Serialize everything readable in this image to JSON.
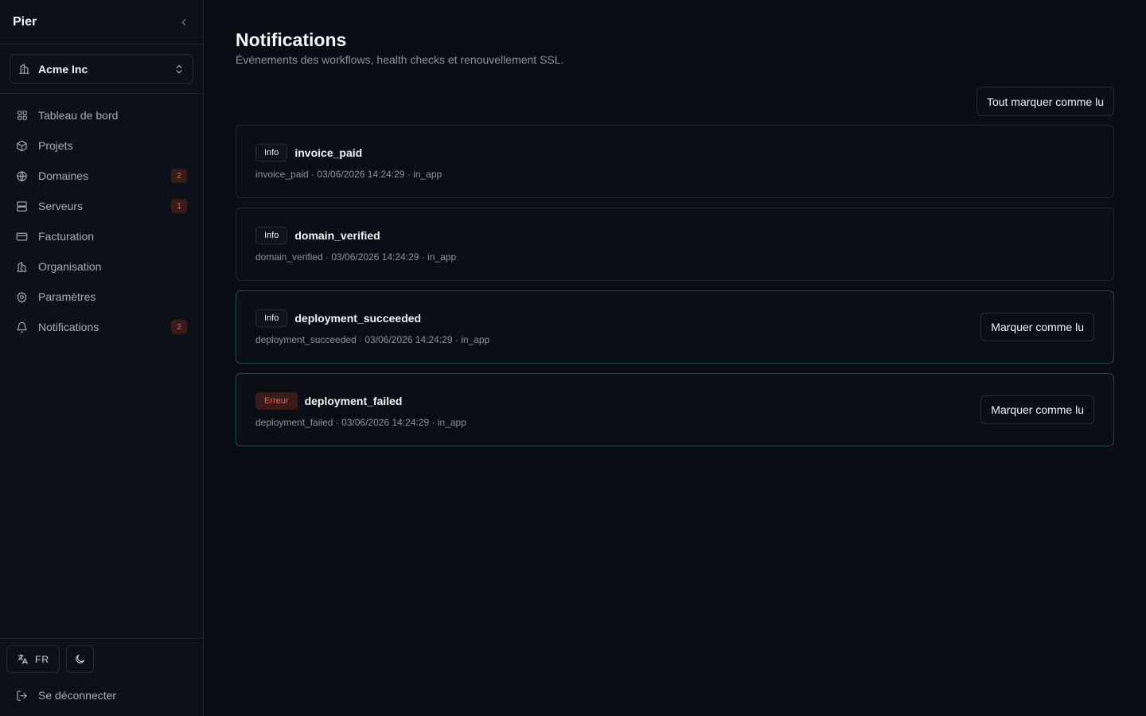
{
  "app": {
    "brand": "Pier"
  },
  "org": {
    "name": "Acme Inc"
  },
  "nav": [
    {
      "label": "Tableau de bord",
      "icon": "dashboard-icon",
      "badge": null
    },
    {
      "label": "Projets",
      "icon": "package-icon",
      "badge": null
    },
    {
      "label": "Domaines",
      "icon": "globe-icon",
      "badge": "2"
    },
    {
      "label": "Serveurs",
      "icon": "server-icon",
      "badge": "1"
    },
    {
      "label": "Facturation",
      "icon": "credit-card-icon",
      "badge": null
    },
    {
      "label": "Organisation",
      "icon": "building-icon",
      "badge": null
    },
    {
      "label": "Paramètres",
      "icon": "gear-icon",
      "badge": null
    },
    {
      "label": "Notifications",
      "icon": "bell-icon",
      "badge": "2"
    }
  ],
  "footer": {
    "lang": "FR",
    "logout": "Se déconnecter"
  },
  "page": {
    "title": "Notifications",
    "subtitle": "Événements des workflows, health checks et renouvellement SSL.",
    "mark_all": "Tout marquer comme lu"
  },
  "notifications": [
    {
      "level": "Info",
      "title": "invoice_paid",
      "meta": "invoice_paid · 03/06/2026 14:24:29 · in_app",
      "action": ""
    },
    {
      "level": "Info",
      "title": "domain_verified",
      "meta": "domain_verified · 03/06/2026 14:24:29 · in_app",
      "action": ""
    },
    {
      "level": "Info",
      "title": "deployment_succeeded",
      "meta": "deployment_succeeded · 03/06/2026 14:24:29 · in_app",
      "action": "Marquer comme lu"
    },
    {
      "level": "Erreur",
      "title": "deployment_failed",
      "meta": "deployment_failed · 03/06/2026 14:24:29 · in_app",
      "action": "Marquer comme lu"
    }
  ],
  "colors": {
    "accent_unread_border": "#1f4c4a",
    "error_text": "#e0664b",
    "error_bg": "#3a1b18"
  }
}
